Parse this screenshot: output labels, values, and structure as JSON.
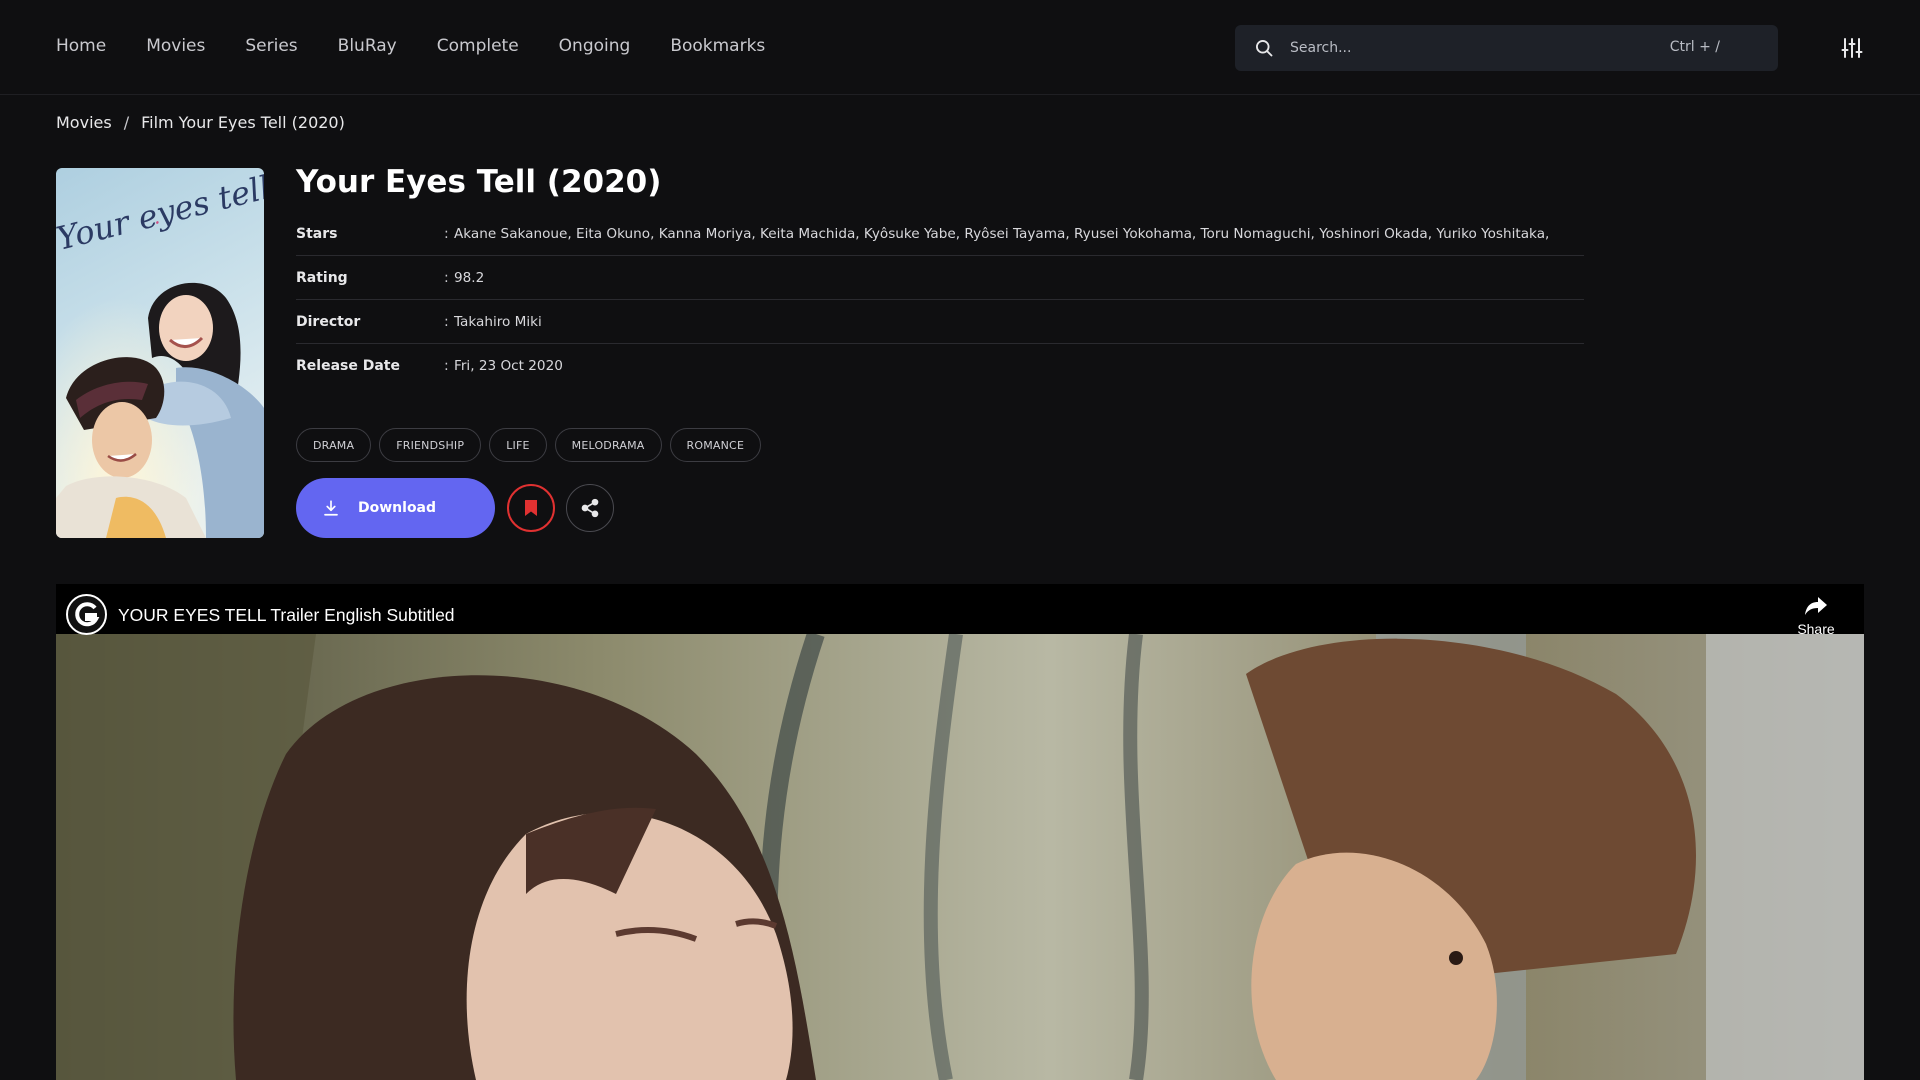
{
  "nav": {
    "items": [
      "Home",
      "Movies",
      "Series",
      "BluRay",
      "Complete",
      "Ongoing",
      "Bookmarks"
    ]
  },
  "search": {
    "placeholder": "Search...",
    "shortcut": "Ctrl + /"
  },
  "breadcrumb": {
    "parent": "Movies",
    "separator": "/",
    "current": "Film Your Eyes Tell (2020)"
  },
  "movie": {
    "title": "Your Eyes Tell (2020)",
    "poster_text": "Your eyes tell",
    "info": [
      {
        "label": "Stars",
        "value": "Akane Sakanoue,  Eita Okuno,  Kanna Moriya,  Keita Machida,  Kyôsuke Yabe,  Ryôsei Tayama,  Ryusei Yokohama,  Toru Nomaguchi,  Yoshinori Okada,  Yuriko Yoshitaka,"
      },
      {
        "label": "Rating",
        "value": "98.2"
      },
      {
        "label": "Director",
        "value": "Takahiro Miki"
      },
      {
        "label": "Release Date",
        "value": "Fri, 23 Oct 2020"
      }
    ],
    "tags": [
      "DRAMA",
      "FRIENDSHIP",
      "LIFE",
      "MELODRAMA",
      "ROMANCE"
    ]
  },
  "actions": {
    "download_label": "Download"
  },
  "video": {
    "title": "YOUR EYES TELL Trailer English Subtitled",
    "share_label": "Share"
  },
  "colors": {
    "background": "#0f0f11",
    "accent": "#6366f1",
    "bookmark": "#e03131"
  }
}
